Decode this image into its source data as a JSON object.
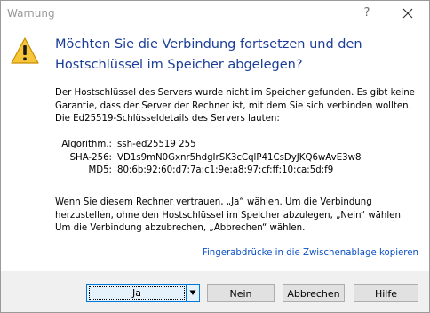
{
  "window": {
    "title": "Warnung",
    "help_glyph": "?"
  },
  "heading": "Möchten Sie die Verbindung fortsetzen und den Hostschlüssel im Speicher abgelegen?",
  "paragraph1": [
    "Der Hostschlüssel des Servers wurde nicht im Speicher gefunden. Es gibt keine",
    "Garantie, dass der Server der Rechner ist, mit dem Sie sich verbinden wollten.",
    "Die Ed25519-Schlüsseldetails des Servers lauten:"
  ],
  "details": [
    {
      "label": "Algorithm.:",
      "value": "ssh-ed25519 255"
    },
    {
      "label": "SHA-256:",
      "value": "VD1s9mN0Gxnr5hdgIrSK3cCqlP41CsDyJKQ6wAvE3w8"
    },
    {
      "label": "MD5:",
      "value": "80:6b:92:60:d7:7a:c1:9e:a8:97:cf:ff:10:ca:5d:f9"
    }
  ],
  "paragraph3": [
    "Wenn Sie diesem Rechner vertrauen, „Ja“ wählen. Um die Verbindung",
    "herzustellen, ohne den Hostschlüssel im Speicher abzulegen, „Nein“ wählen.",
    "Um die Verbindung abzubrechen, „Abbrechen“ wählen."
  ],
  "link": "Fingerabdrücke in die Zwischenablage kopieren",
  "buttons": {
    "yes": "Ja",
    "no": "Nein",
    "cancel": "Abbrechen",
    "help": "Hilfe"
  },
  "icons": {
    "warning": "warning-triangle-icon",
    "close": "close-icon",
    "dropdown": "dropdown-arrow-icon"
  },
  "colors": {
    "heading": "#1a3e96",
    "link": "#0b4fc4",
    "accent": "#0078d7",
    "warning": "#f0c419"
  }
}
